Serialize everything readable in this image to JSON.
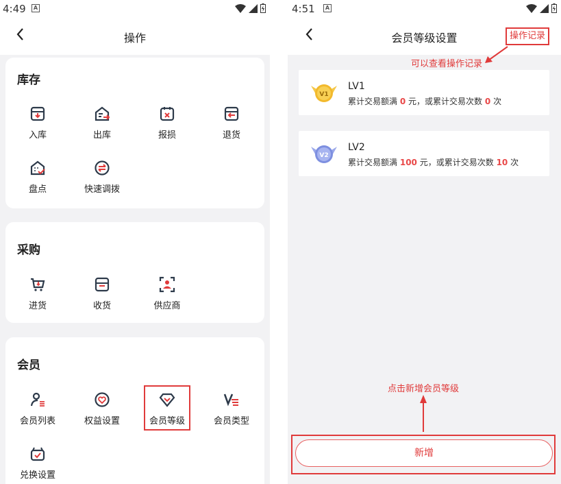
{
  "left": {
    "status": {
      "time": "4:49",
      "notification_icon": "A"
    },
    "nav": {
      "title": "操作"
    },
    "sections": [
      {
        "title": "库存",
        "items": [
          "入库",
          "出库",
          "报损",
          "退货",
          "盘点",
          "快速调拨"
        ]
      },
      {
        "title": "采购",
        "items": [
          "进货",
          "收货",
          "供应商"
        ]
      },
      {
        "title": "会员",
        "items": [
          "会员列表",
          "权益设置",
          "会员等级",
          "会员类型",
          "兑换设置"
        ]
      }
    ]
  },
  "right": {
    "status": {
      "time": "4:51",
      "notification_icon": "A"
    },
    "nav": {
      "title": "会员等级设置",
      "record_button": "操作记录"
    },
    "annotation_record": "可以查看操作记录",
    "levels": [
      {
        "name": "LV1",
        "badge": "V1",
        "desc_pre": "累计交易额满",
        "amount": "0",
        "desc_mid": "元，或累计交易次数",
        "count": "0",
        "desc_post": "次"
      },
      {
        "name": "LV2",
        "badge": "V2",
        "desc_pre": "累计交易额满",
        "amount": "100",
        "desc_mid": "元，或累计交易次数",
        "count": "10",
        "desc_post": "次"
      }
    ],
    "annotation_add": "点击新增会员等级",
    "add_button": "新增"
  },
  "colors": {
    "accent": "#e03a3a",
    "icon": "#2d3a4a",
    "background": "#f2f2f4",
    "gold": "#f2b92c",
    "silver_blue": "#7d8fe0"
  }
}
